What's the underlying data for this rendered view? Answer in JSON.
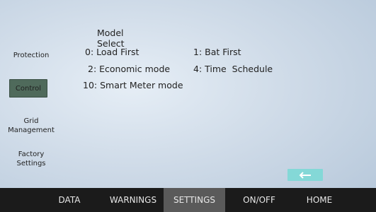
{
  "sidebar": {
    "items": [
      {
        "label": "Protection"
      },
      {
        "label": "Control"
      },
      {
        "label_line1": "Grid",
        "label_line2": "Management"
      },
      {
        "label_line1": "Factory",
        "label_line2": "Settings"
      }
    ]
  },
  "main": {
    "title": "Model Select",
    "options": [
      {
        "text": "0: Load First"
      },
      {
        "text": "1: Bat First"
      },
      {
        "text": "2: Economic mode"
      },
      {
        "text": "4: Time  Schedule"
      },
      {
        "text": "10: Smart Meter mode"
      }
    ]
  },
  "back_button": {
    "icon": "arrow-left-icon",
    "color": "#84d8d7"
  },
  "nav": {
    "items": [
      {
        "label": "DATA"
      },
      {
        "label": "WARNINGS"
      },
      {
        "label": "SETTINGS"
      },
      {
        "label": "ON/OFF"
      },
      {
        "label": "HOME"
      }
    ],
    "active": "SETTINGS",
    "background": "#1b1b1b",
    "active_background": "#5a5a5a"
  },
  "accent_color": "#4f6a5b"
}
